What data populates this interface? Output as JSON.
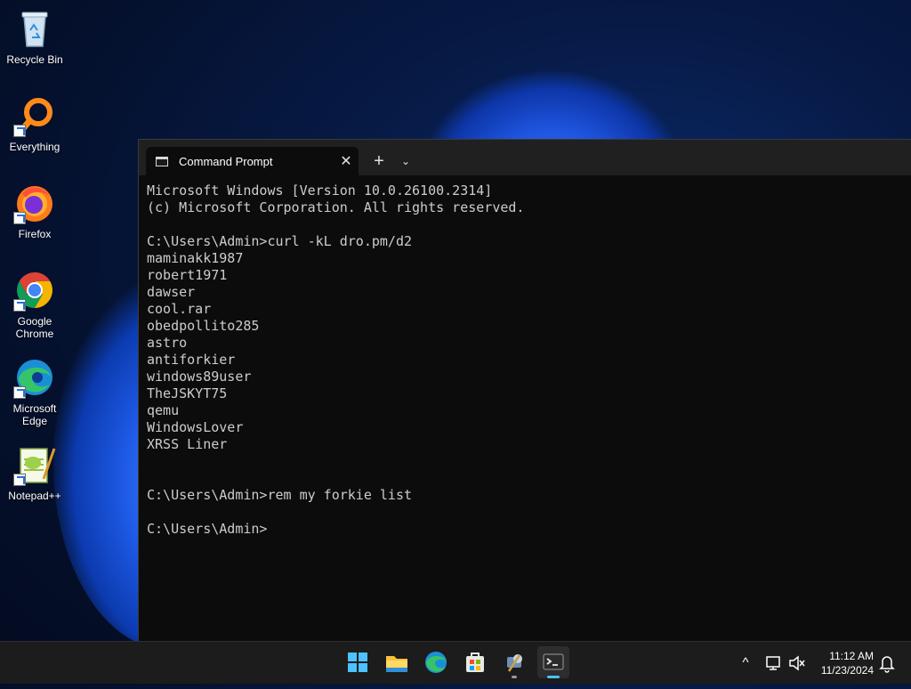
{
  "desktop": {
    "icons": [
      {
        "label": "Recycle Bin",
        "icon": "recycle-bin-icon"
      },
      {
        "label": "Everything",
        "icon": "everything-search-icon"
      },
      {
        "label": "Firefox",
        "icon": "firefox-icon"
      },
      {
        "label": "Google Chrome",
        "icon": "chrome-icon"
      },
      {
        "label": "Microsoft Edge",
        "icon": "edge-icon"
      },
      {
        "label": "Notepad++",
        "icon": "notepadpp-icon"
      }
    ]
  },
  "terminal": {
    "tab_title": "Command Prompt",
    "close_glyph": "✕",
    "new_tab_glyph": "+",
    "dropdown_glyph": "⌄",
    "lines": [
      "Microsoft Windows [Version 10.0.26100.2314]",
      "(c) Microsoft Corporation. All rights reserved.",
      "",
      "C:\\Users\\Admin>curl -kL dro.pm/d2",
      "maminakk1987",
      "robert1971",
      "dawser",
      "cool.rar",
      "obedpollito285",
      "astro",
      "antiforkier",
      "windows89user",
      "TheJSKYT75",
      "qemu",
      "WindowsLover",
      "XRSS Liner",
      "",
      "",
      "C:\\Users\\Admin>rem my forkie list",
      "",
      "C:\\Users\\Admin>"
    ]
  },
  "taskbar": {
    "apps": [
      {
        "name": "start",
        "icon": "windows-start-icon"
      },
      {
        "name": "file-explorer",
        "icon": "folder-icon"
      },
      {
        "name": "edge",
        "icon": "edge-icon"
      },
      {
        "name": "store",
        "icon": "store-icon"
      },
      {
        "name": "settings-tool",
        "icon": "tool-app-icon"
      },
      {
        "name": "terminal",
        "icon": "terminal-icon"
      }
    ],
    "tray": {
      "chevron_glyph": "^",
      "time": "11:12 AM",
      "date": "11/23/2024"
    }
  },
  "colors": {
    "accent": "#4cc2ff",
    "terminal_bg": "#0c0c0c",
    "terminal_text": "#cccccc",
    "taskbar_bg": "#1c1c1c"
  }
}
